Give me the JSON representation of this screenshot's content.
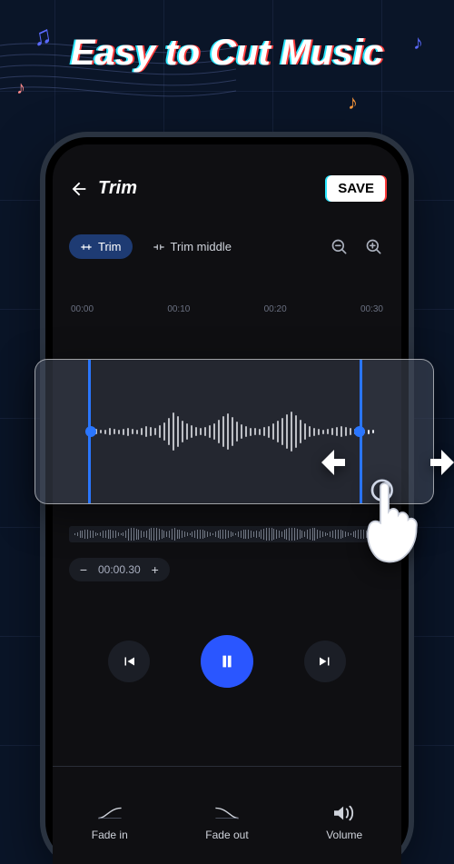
{
  "marketing": {
    "headline": "Easy to Cut Music"
  },
  "header": {
    "title": "Trim",
    "save_label": "SAVE"
  },
  "chips": {
    "trim": "Trim",
    "trim_middle": "Trim middle"
  },
  "timeline": {
    "ticks": [
      "00:00",
      "00:10",
      "00:20",
      "00:30"
    ]
  },
  "time_control": {
    "value": "00:00.30"
  },
  "bottom": {
    "fade_in": "Fade in",
    "fade_out": "Fade out",
    "volume": "Volume"
  },
  "icons": {
    "back": "arrow-left",
    "zoom_out": "zoom-out",
    "zoom_in": "zoom-in",
    "prev": "skip-previous",
    "pause": "pause",
    "next": "skip-next"
  },
  "colors": {
    "accent": "#2a56ff",
    "handle": "#2a76ff",
    "panel": "#0f0f12"
  }
}
